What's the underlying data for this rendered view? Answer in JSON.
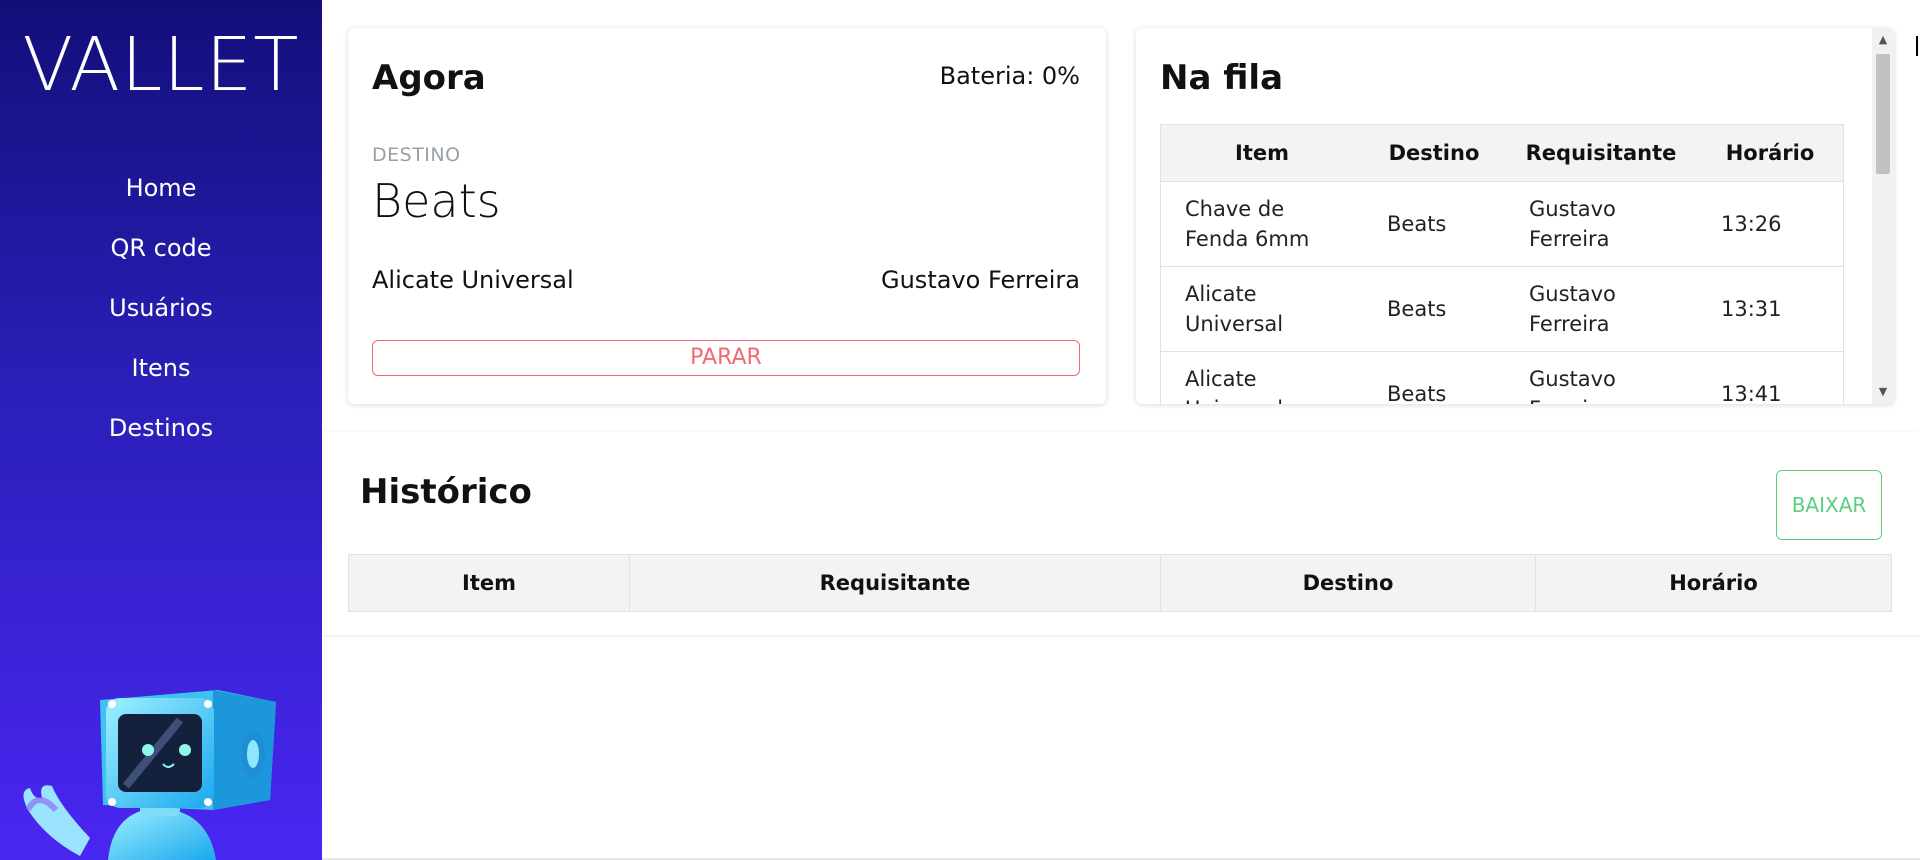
{
  "sidebar": {
    "logo": "VALLET",
    "nav": [
      {
        "label": "Home"
      },
      {
        "label": "QR code"
      },
      {
        "label": "Usuários"
      },
      {
        "label": "Itens"
      },
      {
        "label": "Destinos"
      }
    ]
  },
  "now": {
    "title": "Agora",
    "battery": "Bateria: 0%",
    "destination_label": "DESTINO",
    "destination_value": "Beats",
    "item": "Alicate Universal",
    "requester": "Gustavo Ferreira",
    "stop_label": "PARAR"
  },
  "queue": {
    "title": "Na fila",
    "headers": [
      "Item",
      "Destino",
      "Requisitante",
      "Horário"
    ],
    "rows": [
      {
        "item": "Chave de Fenda 6mm",
        "destination": "Beats",
        "requester": "Gustavo Ferreira",
        "time": "13:26"
      },
      {
        "item": "Alicate Universal",
        "destination": "Beats",
        "requester": "Gustavo Ferreira",
        "time": "13:31"
      },
      {
        "item": "Alicate Universal",
        "destination": "Beats",
        "requester": "Gustavo Ferreira",
        "time": "13:41"
      }
    ]
  },
  "history": {
    "title": "Histórico",
    "download_label": "BAIXAR",
    "headers": [
      "Item",
      "Requisitante",
      "Destino",
      "Horário"
    ]
  },
  "colors": {
    "sidebar_top": "#120f7a",
    "sidebar_bottom": "#4a26f2",
    "stop": "#f06a70",
    "download": "#5ccf7e"
  }
}
